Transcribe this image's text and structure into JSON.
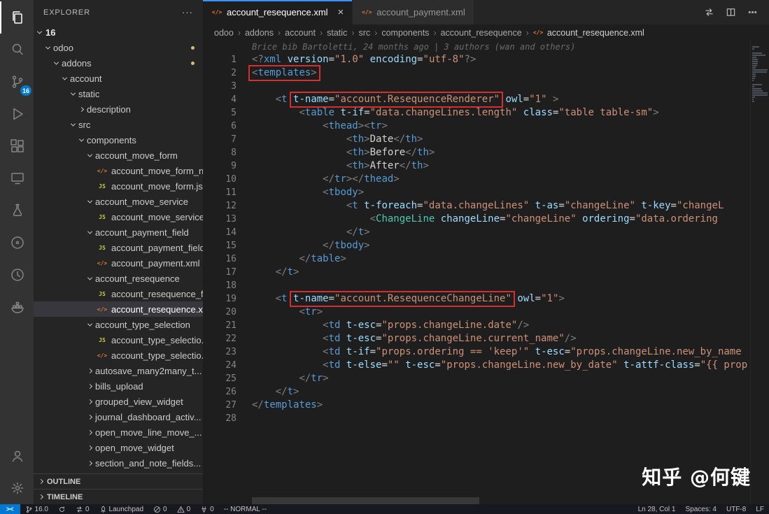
{
  "activity_bar": {
    "badge_color": "#007acc",
    "top": [
      {
        "name": "explorer",
        "icon": "files",
        "active": true
      },
      {
        "name": "search",
        "icon": "search"
      },
      {
        "name": "source-control",
        "icon": "scm",
        "badge": "16"
      },
      {
        "name": "run-and-debug",
        "icon": "debug"
      },
      {
        "name": "extensions",
        "icon": "extensions"
      },
      {
        "name": "remote-explorer",
        "icon": "remote-explorer"
      },
      {
        "name": "testing",
        "icon": "flask"
      },
      {
        "name": "extension-circle",
        "icon": "circle-dot"
      },
      {
        "name": "extension-clock",
        "icon": "clock"
      },
      {
        "name": "docker",
        "icon": "docker"
      }
    ],
    "bottom": [
      {
        "name": "accounts",
        "icon": "account"
      },
      {
        "name": "manage",
        "icon": "gear"
      }
    ]
  },
  "sidebar": {
    "header": "EXPLORER",
    "more_label": "···",
    "root": "16",
    "tree": [
      {
        "label": "odoo",
        "indent": 1,
        "kind": "folder-open",
        "dot": true
      },
      {
        "label": "addons",
        "indent": 2,
        "kind": "folder-open",
        "dot": true
      },
      {
        "label": "account",
        "indent": 3,
        "kind": "folder-open"
      },
      {
        "label": "static",
        "indent": 4,
        "kind": "folder-open"
      },
      {
        "label": "description",
        "indent": 5,
        "kind": "folder-closed"
      },
      {
        "label": "src",
        "indent": 4,
        "kind": "folder-open"
      },
      {
        "label": "components",
        "indent": 5,
        "kind": "folder-open"
      },
      {
        "label": "account_move_form",
        "indent": 6,
        "kind": "folder-open"
      },
      {
        "label": "account_move_form_n...",
        "indent": 7,
        "kind": "xml"
      },
      {
        "label": "account_move_form.js",
        "indent": 7,
        "kind": "js"
      },
      {
        "label": "account_move_service",
        "indent": 6,
        "kind": "folder-open"
      },
      {
        "label": "account_move_service.js",
        "indent": 7,
        "kind": "js"
      },
      {
        "label": "account_payment_field",
        "indent": 6,
        "kind": "folder-open"
      },
      {
        "label": "account_payment_field.js",
        "indent": 7,
        "kind": "js"
      },
      {
        "label": "account_payment.xml",
        "indent": 7,
        "kind": "xml"
      },
      {
        "label": "account_resequence",
        "indent": 6,
        "kind": "folder-open"
      },
      {
        "label": "account_resequence_fi...",
        "indent": 7,
        "kind": "js"
      },
      {
        "label": "account_resequence.xml",
        "indent": 7,
        "kind": "xml",
        "selected": true
      },
      {
        "label": "account_type_selection",
        "indent": 6,
        "kind": "folder-open"
      },
      {
        "label": "account_type_selectio...",
        "indent": 7,
        "kind": "js"
      },
      {
        "label": "account_type_selectio...",
        "indent": 7,
        "kind": "xml"
      },
      {
        "label": "autosave_many2many_t...",
        "indent": 6,
        "kind": "folder-closed"
      },
      {
        "label": "bills_upload",
        "indent": 6,
        "kind": "folder-closed"
      },
      {
        "label": "grouped_view_widget",
        "indent": 6,
        "kind": "folder-closed"
      },
      {
        "label": "journal_dashboard_activ...",
        "indent": 6,
        "kind": "folder-closed"
      },
      {
        "label": "open_move_line_move_...",
        "indent": 6,
        "kind": "folder-closed"
      },
      {
        "label": "open_move_widget",
        "indent": 6,
        "kind": "folder-closed"
      },
      {
        "label": "section_and_note_fields...",
        "indent": 6,
        "kind": "folder-closed"
      }
    ],
    "panels": [
      "OUTLINE",
      "TIMELINE"
    ]
  },
  "editor": {
    "tabs": [
      {
        "label": "account_resequence.xml",
        "active": true
      },
      {
        "label": "account_payment.xml",
        "active": false
      }
    ],
    "tab_actions": [
      {
        "name": "open-changes-icon"
      },
      {
        "name": "split-editor-icon"
      },
      {
        "name": "more-actions-icon"
      }
    ],
    "breadcrumb": [
      "odoo",
      "addons",
      "account",
      "static",
      "src",
      "components",
      "account_resequence",
      "account_resequence.xml"
    ],
    "blame": "Brice bib Bartoletti, 24 months ago | 3 authors (wan and others)",
    "lines": [
      [
        [
          "p",
          "<?"
        ],
        [
          "g",
          "xml"
        ],
        [
          "t",
          " "
        ],
        [
          "a",
          "version"
        ],
        [
          "t",
          "="
        ],
        [
          "q",
          "\"1.0\""
        ],
        [
          "t",
          " "
        ],
        [
          "a",
          "encoding"
        ],
        [
          "t",
          "="
        ],
        [
          "q",
          "\"utf-8\""
        ],
        [
          "p",
          "?>"
        ]
      ],
      [
        [
          "p",
          "<",
          1
        ],
        [
          "g",
          "templates",
          1
        ],
        [
          "p",
          ">",
          1
        ]
      ],
      [],
      [
        [
          "t",
          "    "
        ],
        [
          "p",
          "<"
        ],
        [
          "g",
          "t"
        ],
        [
          "t",
          " "
        ],
        [
          "a",
          "t-name",
          1
        ],
        [
          "t",
          "=",
          1
        ],
        [
          "q",
          "\"account.ResequenceRenderer\"",
          1
        ],
        [
          "t",
          " "
        ],
        [
          "a",
          "owl"
        ],
        [
          "t",
          "="
        ],
        [
          "q",
          "\"1\""
        ],
        [
          "t",
          " "
        ],
        [
          "p",
          ">"
        ]
      ],
      [
        [
          "t",
          "        "
        ],
        [
          "p",
          "<"
        ],
        [
          "g",
          "table"
        ],
        [
          "t",
          " "
        ],
        [
          "a",
          "t-if"
        ],
        [
          "t",
          "="
        ],
        [
          "q",
          "\"data.changeLines.length\""
        ],
        [
          "t",
          " "
        ],
        [
          "a",
          "class"
        ],
        [
          "t",
          "="
        ],
        [
          "q",
          "\"table table-sm\""
        ],
        [
          "p",
          ">"
        ]
      ],
      [
        [
          "t",
          "            "
        ],
        [
          "p",
          "<"
        ],
        [
          "g",
          "thead"
        ],
        [
          "p",
          "><"
        ],
        [
          "g",
          "tr"
        ],
        [
          "p",
          ">"
        ]
      ],
      [
        [
          "t",
          "                "
        ],
        [
          "p",
          "<"
        ],
        [
          "g",
          "th"
        ],
        [
          "p",
          ">"
        ],
        [
          "t",
          "Date"
        ],
        [
          "p",
          "</"
        ],
        [
          "g",
          "th"
        ],
        [
          "p",
          ">"
        ]
      ],
      [
        [
          "t",
          "                "
        ],
        [
          "p",
          "<"
        ],
        [
          "g",
          "th"
        ],
        [
          "p",
          ">"
        ],
        [
          "t",
          "Before"
        ],
        [
          "p",
          "</"
        ],
        [
          "g",
          "th"
        ],
        [
          "p",
          ">"
        ]
      ],
      [
        [
          "t",
          "                "
        ],
        [
          "p",
          "<"
        ],
        [
          "g",
          "th"
        ],
        [
          "p",
          ">"
        ],
        [
          "t",
          "After"
        ],
        [
          "p",
          "</"
        ],
        [
          "g",
          "th"
        ],
        [
          "p",
          ">"
        ]
      ],
      [
        [
          "t",
          "            "
        ],
        [
          "p",
          "</"
        ],
        [
          "g",
          "tr"
        ],
        [
          "p",
          "></"
        ],
        [
          "g",
          "thead"
        ],
        [
          "p",
          ">"
        ]
      ],
      [
        [
          "t",
          "            "
        ],
        [
          "p",
          "<"
        ],
        [
          "g",
          "tbody"
        ],
        [
          "p",
          ">"
        ]
      ],
      [
        [
          "t",
          "                "
        ],
        [
          "p",
          "<"
        ],
        [
          "g",
          "t"
        ],
        [
          "t",
          " "
        ],
        [
          "a",
          "t-foreach"
        ],
        [
          "t",
          "="
        ],
        [
          "q",
          "\"data.changeLines\""
        ],
        [
          "t",
          " "
        ],
        [
          "a",
          "t-as"
        ],
        [
          "t",
          "="
        ],
        [
          "q",
          "\"changeLine\""
        ],
        [
          "t",
          " "
        ],
        [
          "a",
          "t-key"
        ],
        [
          "t",
          "="
        ],
        [
          "q",
          "\"changeL"
        ]
      ],
      [
        [
          "t",
          "                    "
        ],
        [
          "p",
          "<"
        ],
        [
          "c",
          "ChangeLine"
        ],
        [
          "t",
          " "
        ],
        [
          "a",
          "changeLine"
        ],
        [
          "t",
          "="
        ],
        [
          "q",
          "\"changeLine\""
        ],
        [
          "t",
          " "
        ],
        [
          "a",
          "ordering"
        ],
        [
          "t",
          "="
        ],
        [
          "q",
          "\"data.ordering"
        ]
      ],
      [
        [
          "t",
          "                "
        ],
        [
          "p",
          "</"
        ],
        [
          "g",
          "t"
        ],
        [
          "p",
          ">"
        ]
      ],
      [
        [
          "t",
          "            "
        ],
        [
          "p",
          "</"
        ],
        [
          "g",
          "tbody"
        ],
        [
          "p",
          ">"
        ]
      ],
      [
        [
          "t",
          "        "
        ],
        [
          "p",
          "</"
        ],
        [
          "g",
          "table"
        ],
        [
          "p",
          ">"
        ]
      ],
      [
        [
          "t",
          "    "
        ],
        [
          "p",
          "</"
        ],
        [
          "g",
          "t"
        ],
        [
          "p",
          ">"
        ]
      ],
      [],
      [
        [
          "t",
          "    "
        ],
        [
          "p",
          "<"
        ],
        [
          "g",
          "t"
        ],
        [
          "t",
          " "
        ],
        [
          "a",
          "t-name",
          1
        ],
        [
          "t",
          "=",
          1
        ],
        [
          "q",
          "\"account.ResequenceChangeLine\"",
          1
        ],
        [
          "t",
          " "
        ],
        [
          "a",
          "owl"
        ],
        [
          "t",
          "="
        ],
        [
          "q",
          "\"1\""
        ],
        [
          "p",
          ">"
        ]
      ],
      [
        [
          "t",
          "        "
        ],
        [
          "p",
          "<"
        ],
        [
          "g",
          "tr"
        ],
        [
          "p",
          ">"
        ]
      ],
      [
        [
          "t",
          "            "
        ],
        [
          "p",
          "<"
        ],
        [
          "g",
          "td"
        ],
        [
          "t",
          " "
        ],
        [
          "a",
          "t-esc"
        ],
        [
          "t",
          "="
        ],
        [
          "q",
          "\"props.changeLine.date\""
        ],
        [
          "p",
          "/>"
        ]
      ],
      [
        [
          "t",
          "            "
        ],
        [
          "p",
          "<"
        ],
        [
          "g",
          "td"
        ],
        [
          "t",
          " "
        ],
        [
          "a",
          "t-esc"
        ],
        [
          "t",
          "="
        ],
        [
          "q",
          "\"props.changeLine.current_name\""
        ],
        [
          "p",
          "/>"
        ]
      ],
      [
        [
          "t",
          "            "
        ],
        [
          "p",
          "<"
        ],
        [
          "g",
          "td"
        ],
        [
          "t",
          " "
        ],
        [
          "a",
          "t-if"
        ],
        [
          "t",
          "="
        ],
        [
          "q",
          "\"props.ordering == 'keep'\""
        ],
        [
          "t",
          " "
        ],
        [
          "a",
          "t-esc"
        ],
        [
          "t",
          "="
        ],
        [
          "q",
          "\"props.changeLine.new_by_name"
        ]
      ],
      [
        [
          "t",
          "            "
        ],
        [
          "p",
          "<"
        ],
        [
          "g",
          "td"
        ],
        [
          "t",
          " "
        ],
        [
          "a",
          "t-else"
        ],
        [
          "t",
          "="
        ],
        [
          "q",
          "\"\""
        ],
        [
          "t",
          " "
        ],
        [
          "a",
          "t-esc"
        ],
        [
          "t",
          "="
        ],
        [
          "q",
          "\"props.changeLine.new_by_date\""
        ],
        [
          "t",
          " "
        ],
        [
          "a",
          "t-attf-class"
        ],
        [
          "t",
          "="
        ],
        [
          "q",
          "\"{{ prop"
        ]
      ],
      [
        [
          "t",
          "        "
        ],
        [
          "p",
          "</"
        ],
        [
          "g",
          "tr"
        ],
        [
          "p",
          ">"
        ]
      ],
      [
        [
          "t",
          "    "
        ],
        [
          "p",
          "</"
        ],
        [
          "g",
          "t"
        ],
        [
          "p",
          ">"
        ]
      ],
      [
        [
          "p",
          "</"
        ],
        [
          "g",
          "templates"
        ],
        [
          "p",
          ">"
        ]
      ],
      []
    ]
  },
  "status_bar": {
    "left": [
      {
        "name": "remote-indicator",
        "icon": "remote",
        "label": "><"
      },
      {
        "name": "git-branch",
        "icon": "branch",
        "label": "16.0"
      },
      {
        "name": "sync-changes",
        "icon": "sync",
        "label": ""
      },
      {
        "name": "compare-changes",
        "icon": "compare",
        "label": "0"
      },
      {
        "name": "launchpad",
        "icon": "rocket",
        "label": "Launchpad"
      },
      {
        "name": "problems-errors",
        "icon": "error",
        "label": "0"
      },
      {
        "name": "problems-warnings",
        "icon": "warning",
        "label": "0"
      },
      {
        "name": "ports",
        "icon": "plug",
        "label": "0"
      },
      {
        "name": "vim-mode",
        "icon": "",
        "label": "-- NORMAL --"
      }
    ],
    "right": [
      {
        "name": "cursor-position",
        "label": "Ln 28, Col 1"
      },
      {
        "name": "indentation",
        "label": "Spaces: 4"
      },
      {
        "name": "encoding",
        "label": "UTF-8"
      },
      {
        "name": "eol",
        "label": "LF"
      }
    ]
  },
  "watermark": "知乎 @何键",
  "colors": {
    "accent": "#007acc",
    "annotation_red": "#d32f2f",
    "tag": "#569cd6",
    "attribute": "#9cdcfe",
    "string": "#ce9178",
    "component": "#4ec9b0",
    "punctuation": "#808080",
    "js_icon": "#cbcb41",
    "xml_icon": "#e37933",
    "active_tab_border": "#3794ff"
  }
}
